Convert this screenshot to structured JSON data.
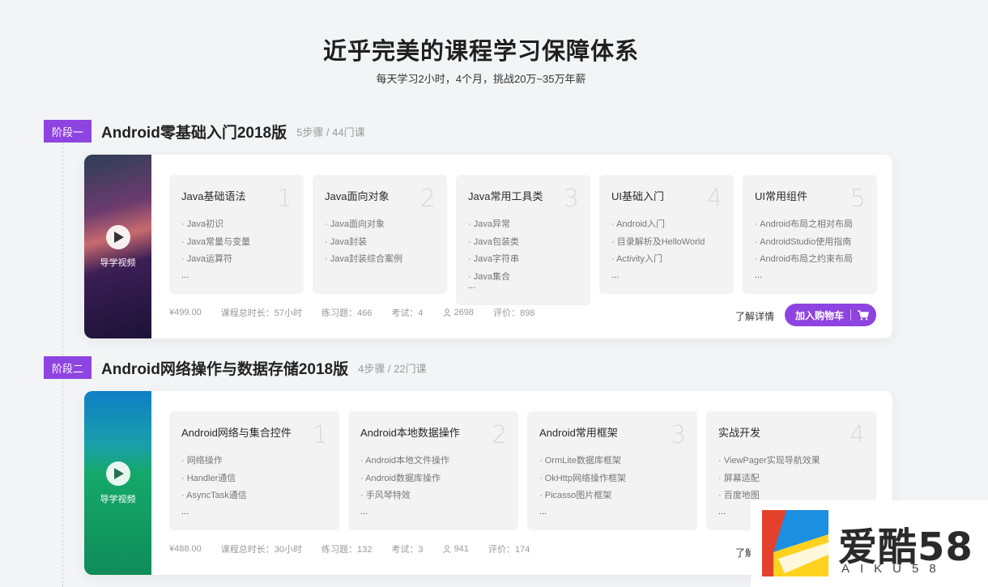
{
  "header": {
    "title": "近乎完美的课程学习保障体系",
    "subtitle": "每天学习2小时，4个月，挑战20万~35万年薪"
  },
  "stages": [
    {
      "tag": "阶段一",
      "title": "Android零基础入门2018版",
      "meta": "5步骤 / 44门课",
      "cover_label": "导学视频",
      "steps": [
        {
          "title": "Java基础语法",
          "num": "1",
          "items": [
            "Java初识",
            "Java常量与变量",
            "Java运算符"
          ],
          "more": "..."
        },
        {
          "title": "Java面向对象",
          "num": "2",
          "items": [
            "Java面向对象",
            "Java封装",
            "Java封装综合案例"
          ],
          "more": ""
        },
        {
          "title": "Java常用工具类",
          "num": "3",
          "items": [
            "Java异常",
            "Java包装类",
            "Java字符串",
            "Java集合"
          ],
          "more": "..."
        },
        {
          "title": "UI基础入门",
          "num": "4",
          "items": [
            "Android入门",
            "目录解析及HelloWorld",
            "Activity入门"
          ],
          "more": "..."
        },
        {
          "title": "UI常用组件",
          "num": "5",
          "items": [
            "Android布局之相对布局",
            "AndroidStudio使用指南",
            "Android布局之约束布局"
          ],
          "more": "..."
        }
      ],
      "stats": {
        "price": "¥499.00",
        "duration": "课程总时长：57小时",
        "exercises": "练习题：466",
        "exams": "考试：4",
        "students": "2698",
        "rating": "评价：898"
      },
      "detail_label": "了解详情",
      "cart_label": "加入购物车"
    },
    {
      "tag": "阶段二",
      "title": "Android网络操作与数据存储2018版",
      "meta": "4步骤 / 22门课",
      "cover_label": "导学视频",
      "steps": [
        {
          "title": "Android网络与集合控件",
          "num": "1",
          "items": [
            "网络操作",
            "Handler通信",
            "AsyncTask通信"
          ],
          "more": "..."
        },
        {
          "title": "Android本地数据操作",
          "num": "2",
          "items": [
            "Android本地文件操作",
            "Android数据库操作",
            "手风琴特效"
          ],
          "more": "..."
        },
        {
          "title": "Android常用框架",
          "num": "3",
          "items": [
            "OrmLite数据库框架",
            "OkHttp网络操作框架",
            "Picasso图片框架"
          ],
          "more": "..."
        },
        {
          "title": "实战开发",
          "num": "4",
          "items": [
            "ViewPager实现导航效果",
            "屏幕适配",
            "百度地图"
          ],
          "more": "..."
        }
      ],
      "stats": {
        "price": "¥488.00",
        "duration": "课程总时长：30小时",
        "exercises": "练习题：132",
        "exams": "考试：3",
        "students": "941",
        "rating": "评价：174"
      },
      "detail_label": "了解详情"
    }
  ],
  "watermark": {
    "title": "爱酷58",
    "sub": "AIKU58"
  },
  "colors": {
    "accent": "#8e44e0",
    "background": "#f3f4f6"
  },
  "icons": {
    "play": "play-icon",
    "cart": "cart-icon",
    "user": "user-icon"
  }
}
